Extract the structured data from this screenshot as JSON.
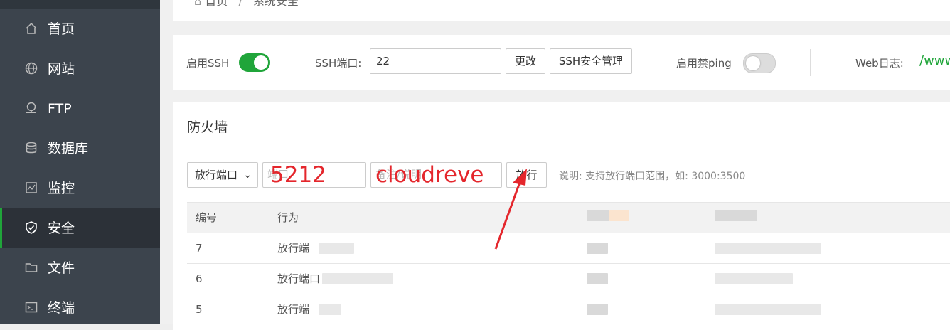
{
  "sidebar": {
    "items": [
      {
        "label": "首页",
        "icon": "home-icon"
      },
      {
        "label": "网站",
        "icon": "globe-icon"
      },
      {
        "label": "FTP",
        "icon": "ftp-icon"
      },
      {
        "label": "数据库",
        "icon": "database-icon"
      },
      {
        "label": "监控",
        "icon": "monitor-icon"
      },
      {
        "label": "安全",
        "icon": "shield-icon",
        "active": true
      },
      {
        "label": "文件",
        "icon": "folder-icon"
      },
      {
        "label": "终端",
        "icon": "terminal-icon"
      }
    ]
  },
  "breadcrumb": {
    "home": "首页",
    "separator": "/",
    "current": "系统安全"
  },
  "ssh": {
    "enable_label": "启用SSH",
    "enabled": true,
    "port_label": "SSH端口:",
    "port_value": "22",
    "change_button": "更改",
    "manage_button": "SSH安全管理",
    "ping_label": "启用禁ping",
    "ping_enabled": false,
    "weblog_label": "Web日志:",
    "weblog_value": "/www"
  },
  "firewall": {
    "title": "防火墙",
    "select_value": "放行端口",
    "port_placeholder": "端口",
    "port_value": "5212",
    "note_placeholder": "备注/说明",
    "note_value": "cloudreve",
    "allow_button": "放行",
    "hint": "说明: 支持放行端口范围，如: 3000:3500",
    "columns": [
      "编号",
      "行为"
    ],
    "rows": [
      {
        "id": "7",
        "action": "放行端"
      },
      {
        "id": "6",
        "action": "放行端口"
      },
      {
        "id": "5",
        "action": "放行端"
      }
    ]
  },
  "colors": {
    "accent": "#20a53a",
    "annotation": "#e4262c",
    "sidebar_bg": "#3c444d"
  }
}
